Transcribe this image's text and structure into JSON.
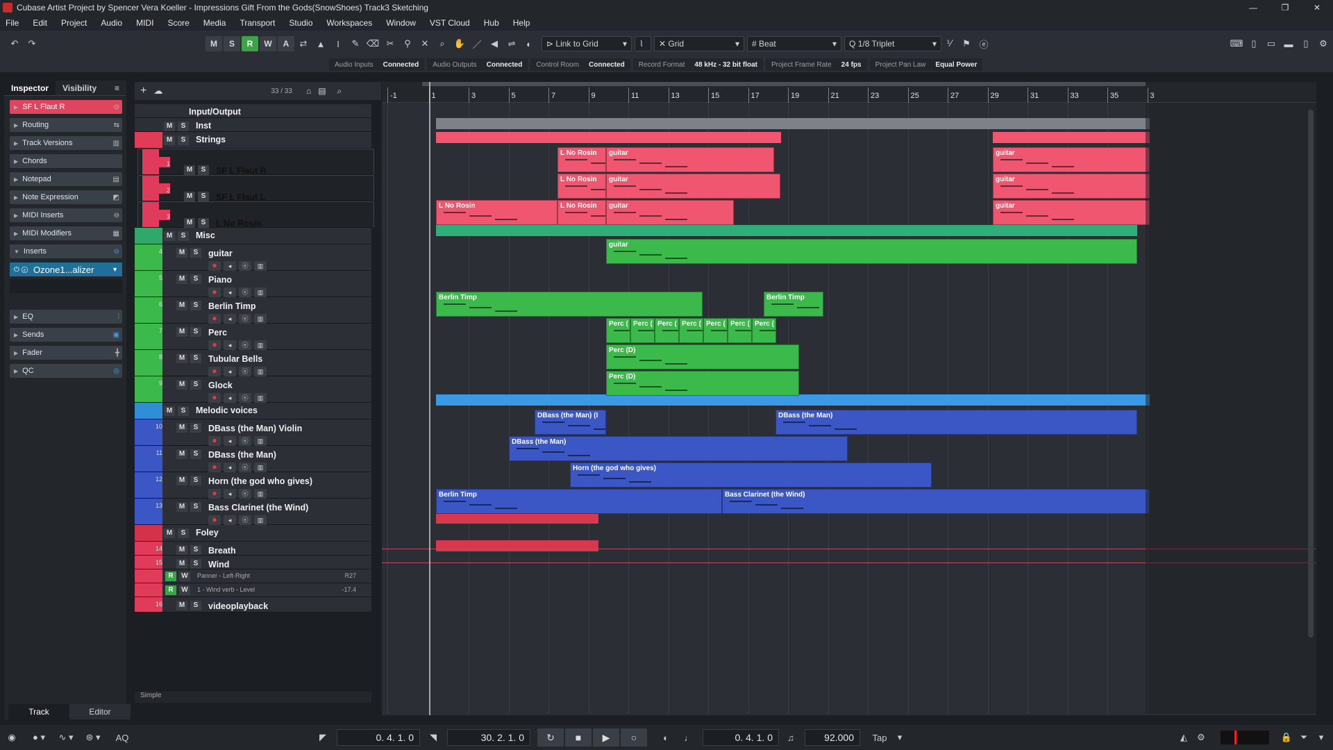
{
  "title": "Cubase Artist Project by Spencer Vera Koeller - Impressions Gift From the Gods(SnowShoes) Track3 Sketching",
  "menu": [
    "File",
    "Edit",
    "Project",
    "Audio",
    "MIDI",
    "Score",
    "Media",
    "Transport",
    "Studio",
    "Workspaces",
    "Window",
    "VST Cloud",
    "Hub",
    "Help"
  ],
  "toolbar": {
    "buttons_mswra": [
      "M",
      "S",
      "R",
      "W",
      "A"
    ],
    "snap_mode": "Link to Grid",
    "grid_type": "Grid",
    "grid_value": "Beat",
    "quantize": "1/8 Triplet"
  },
  "status": [
    {
      "k": "Audio Inputs",
      "v": "Connected"
    },
    {
      "k": "Audio Outputs",
      "v": "Connected"
    },
    {
      "k": "Control Room",
      "v": "Connected"
    },
    {
      "k": "Record Format",
      "v": "48 kHz - 32 bit float"
    },
    {
      "k": "Project Frame Rate",
      "v": "24 fps"
    },
    {
      "k": "Project Pan Law",
      "v": "Equal Power"
    }
  ],
  "inspector": {
    "tabs": [
      "Inspector",
      "Visibility"
    ],
    "selected_track": "SF L Flaut R",
    "sections": [
      "Routing",
      "Track Versions",
      "Chords",
      "Notepad",
      "Note Expression",
      "MIDI Inserts",
      "MIDI Modifiers",
      "Inserts"
    ],
    "insert_plugin": "Ozone1...alizer",
    "sections2": [
      "EQ",
      "Sends",
      "Fader",
      "QC"
    ],
    "bottom_tabs": [
      "Track",
      "Editor"
    ]
  },
  "tracklist_header": {
    "count": "33 / 33"
  },
  "tracks": [
    {
      "kind": "folder",
      "name": "Input/Output"
    },
    {
      "kind": "folder",
      "name": "Inst",
      "ms": [
        "M",
        "S"
      ]
    },
    {
      "kind": "folder",
      "name": "Strings",
      "ms": [
        "M",
        "S"
      ]
    },
    {
      "kind": "track",
      "num": "1",
      "name": "SF L Flaut R",
      "ms": [
        "M",
        "S"
      ]
    },
    {
      "kind": "track",
      "num": "2",
      "name": "SF L Flaut L",
      "ms": [
        "M",
        "S"
      ]
    },
    {
      "kind": "track",
      "num": "3",
      "name": "L No Rosin",
      "ms": [
        "M",
        "S"
      ]
    },
    {
      "kind": "folder",
      "name": "Misc",
      "ms": [
        "M",
        "S"
      ]
    },
    {
      "kind": "track",
      "num": "4",
      "name": "guitar",
      "ms": [
        "M",
        "S"
      ]
    },
    {
      "kind": "track",
      "num": "5",
      "name": "Piano",
      "ms": [
        "M",
        "S"
      ]
    },
    {
      "kind": "track",
      "num": "6",
      "name": "Berlin Timp",
      "ms": [
        "M",
        "S"
      ]
    },
    {
      "kind": "track",
      "num": "7",
      "name": "Perc",
      "ms": [
        "M",
        "S"
      ]
    },
    {
      "kind": "track",
      "num": "8",
      "name": "Tubular Bells",
      "ms": [
        "M",
        "S"
      ]
    },
    {
      "kind": "track",
      "num": "9",
      "name": "Glock",
      "ms": [
        "M",
        "S"
      ]
    },
    {
      "kind": "folder",
      "name": "Melodic voices",
      "ms": [
        "M",
        "S"
      ]
    },
    {
      "kind": "track",
      "num": "10",
      "name": "DBass (the Man) Violin",
      "ms": [
        "M",
        "S"
      ]
    },
    {
      "kind": "track",
      "num": "11",
      "name": "DBass (the Man)",
      "ms": [
        "M",
        "S"
      ]
    },
    {
      "kind": "track",
      "num": "12",
      "name": "Horn (the god who gives)",
      "ms": [
        "M",
        "S"
      ]
    },
    {
      "kind": "track",
      "num": "13",
      "name": "Bass Clarinet (the Wind)",
      "ms": [
        "M",
        "S"
      ]
    },
    {
      "kind": "folder",
      "name": "Foley",
      "ms": [
        "M",
        "S"
      ]
    },
    {
      "kind": "track",
      "num": "14",
      "name": "Breath",
      "ms": [
        "M",
        "S"
      ]
    },
    {
      "kind": "track",
      "num": "15",
      "name": "Wind",
      "ms": [
        "M",
        "S"
      ]
    },
    {
      "kind": "auto",
      "name": "Panner - Left-Right",
      "val": "R27",
      "rw": [
        "R",
        "W"
      ]
    },
    {
      "kind": "auto",
      "name": "1 - Wind verb - Level",
      "val": "-17.4",
      "rw": [
        "R",
        "W"
      ]
    },
    {
      "kind": "track",
      "num": "16",
      "name": "videoplayback",
      "ms": [
        "M",
        "S"
      ]
    }
  ],
  "tracklist_footer": "Simple",
  "ruler": [
    "-1",
    "1",
    "3",
    "5",
    "7",
    "9",
    "11",
    "13",
    "15",
    "17",
    "19",
    "21",
    "23",
    "25",
    "27",
    "29",
    "31",
    "33",
    "35",
    "3"
  ],
  "events": {
    "lnorosin": "L No Rosin",
    "guitar": "guitar",
    "berlintimp": "Berlin Timp",
    "perc": "Perc (",
    "percd": "Perc (D)",
    "dbassviolin": "DBass (the Man) (I",
    "dbass": "DBass (the Man)",
    "horn": "Horn (the god who gives)",
    "bassclar": "Bass Clarinet (the Wind)"
  },
  "transport": {
    "left_locator": "0. 4. 1. 0",
    "right_locator": "30. 2. 1. 0",
    "position": "0. 4. 1. 0",
    "tempo": "92.000",
    "tap": "Tap",
    "aq": "AQ"
  },
  "colors": {
    "red": "#f0566f",
    "green": "#3cb94b",
    "blue": "#3b57c6",
    "foley": "#d8384d",
    "accent": "#3aa447"
  }
}
